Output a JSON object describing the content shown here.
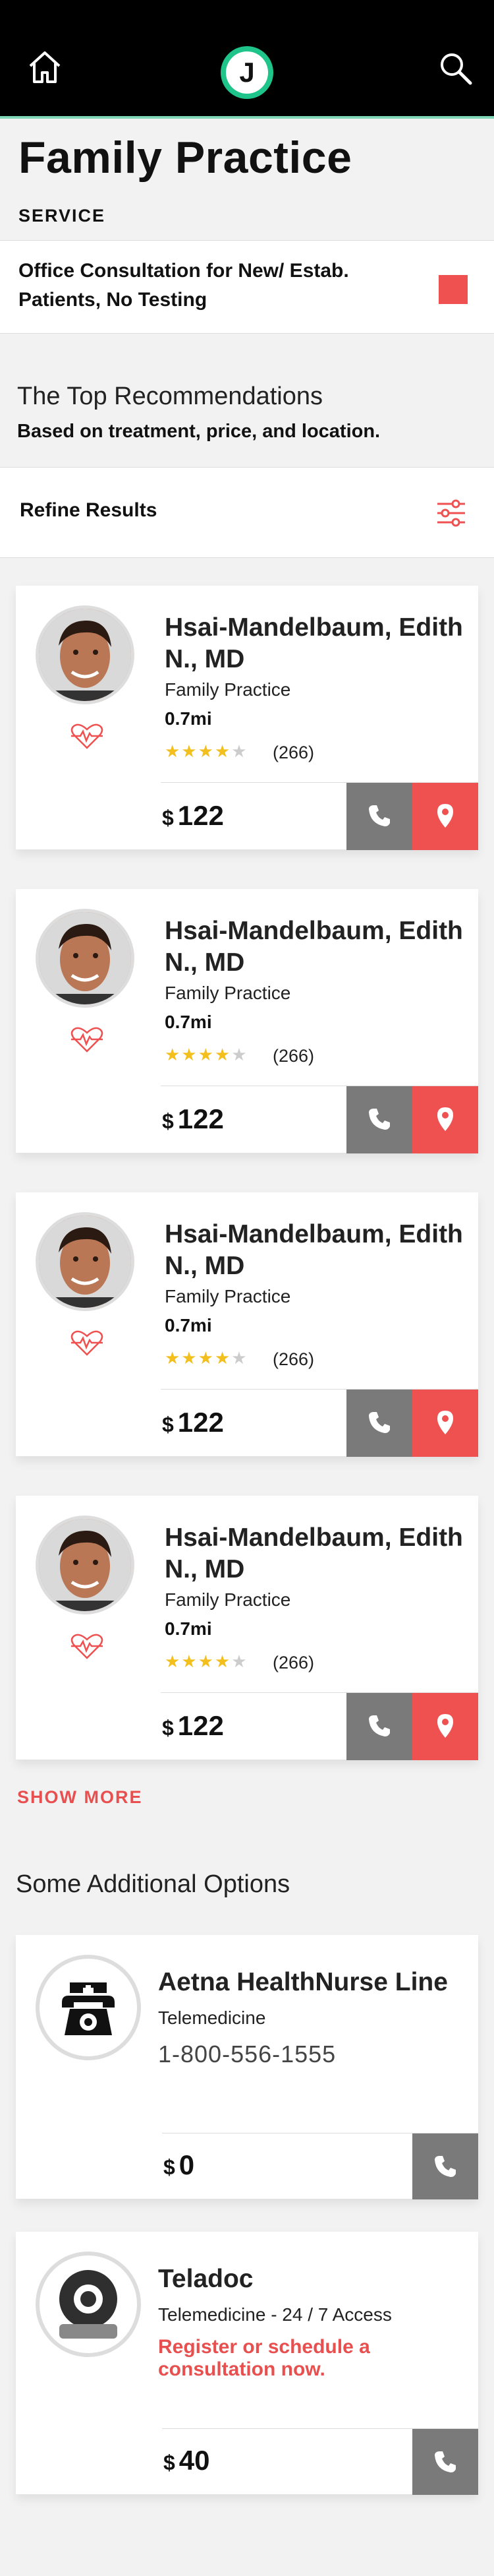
{
  "header": {
    "logo_letter": "J",
    "colors": {
      "bar": "#000000",
      "accent": "#1ec48a"
    }
  },
  "page": {
    "title": "Family Practice",
    "service_label": "SERVICE",
    "service_text": "Office Consultation for New/ Estab. Patients, No Testing"
  },
  "recommendations": {
    "title": "The Top Recommendations",
    "subtitle": "Based on treatment, price, and location.",
    "refine_label": "Refine Results"
  },
  "providers": [
    {
      "name": "Hsai-Mandelbaum, Edith N., MD",
      "specialty": "Family Practice",
      "distance": "0.7mi",
      "rating": 4,
      "reviews": "(266)",
      "currency": "$",
      "price": "122"
    },
    {
      "name": "Hsai-Mandelbaum, Edith N., MD",
      "specialty": "Family Practice",
      "distance": "0.7mi",
      "rating": 4,
      "reviews": "(266)",
      "currency": "$",
      "price": "122"
    },
    {
      "name": "Hsai-Mandelbaum, Edith N., MD",
      "specialty": "Family Practice",
      "distance": "0.7mi",
      "rating": 4,
      "reviews": "(266)",
      "currency": "$",
      "price": "122"
    },
    {
      "name": "Hsai-Mandelbaum, Edith N., MD",
      "specialty": "Family Practice",
      "distance": "0.7mi",
      "rating": 4,
      "reviews": "(266)",
      "currency": "$",
      "price": "122"
    }
  ],
  "show_more": "SHOW MORE",
  "additional": {
    "title": "Some Additional Options",
    "options": [
      {
        "name": "Aetna HealthNurse Line",
        "subtitle": "Telemedicine",
        "phone": "1-800-556-1555",
        "currency": "$",
        "price": "0",
        "icon": "nurse-phone-icon"
      },
      {
        "name": "Teladoc",
        "subtitle": "Telemedicine - 24 / 7 Access",
        "link": "Register or schedule a consultation now.",
        "currency": "$",
        "price": "40",
        "icon": "webcam-icon"
      }
    ]
  },
  "icons": {
    "home": "home-icon",
    "search": "search-icon",
    "filter": "filter-icon",
    "heart": "heartbeat-icon",
    "phone": "phone-icon",
    "map": "map-pin-icon"
  },
  "colors": {
    "accent_red": "#ef5050",
    "button_gray": "#7a7a7a",
    "star": "#f2bf1d"
  }
}
